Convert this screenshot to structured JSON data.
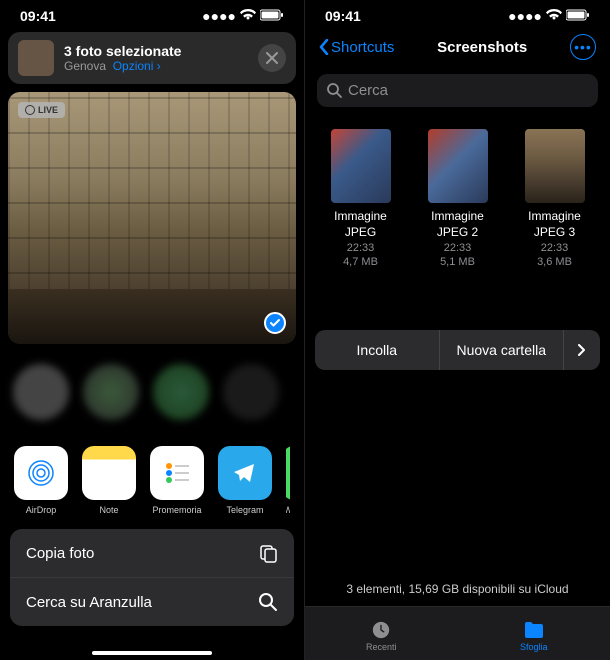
{
  "status": {
    "time": "09:41"
  },
  "left": {
    "share": {
      "title": "3 foto selezionate",
      "location": "Genova",
      "options": "Opzioni",
      "live_badge": "LIVE"
    },
    "apps": [
      {
        "label": "AirDrop"
      },
      {
        "label": "Note"
      },
      {
        "label": "Promemoria"
      },
      {
        "label": "Telegram"
      },
      {
        "label": "W"
      }
    ],
    "actions": {
      "copy": "Copia foto",
      "search": "Cerca su Aranzulla"
    }
  },
  "right": {
    "nav": {
      "back": "Shortcuts",
      "title": "Screenshots"
    },
    "search_placeholder": "Cerca",
    "files": [
      {
        "name_l1": "Immagine",
        "name_l2": "JPEG",
        "time": "22:33",
        "size": "4,7 MB"
      },
      {
        "name_l1": "Immagine",
        "name_l2": "JPEG 2",
        "time": "22:33",
        "size": "5,1 MB"
      },
      {
        "name_l1": "Immagine",
        "name_l2": "JPEG 3",
        "time": "22:33",
        "size": "3,6 MB"
      }
    ],
    "context": {
      "paste": "Incolla",
      "newfolder": "Nuova cartella"
    },
    "footer": "3 elementi, 15,69 GB disponibili su iCloud",
    "tabs": {
      "recent": "Recenti",
      "browse": "Sfoglia"
    }
  }
}
